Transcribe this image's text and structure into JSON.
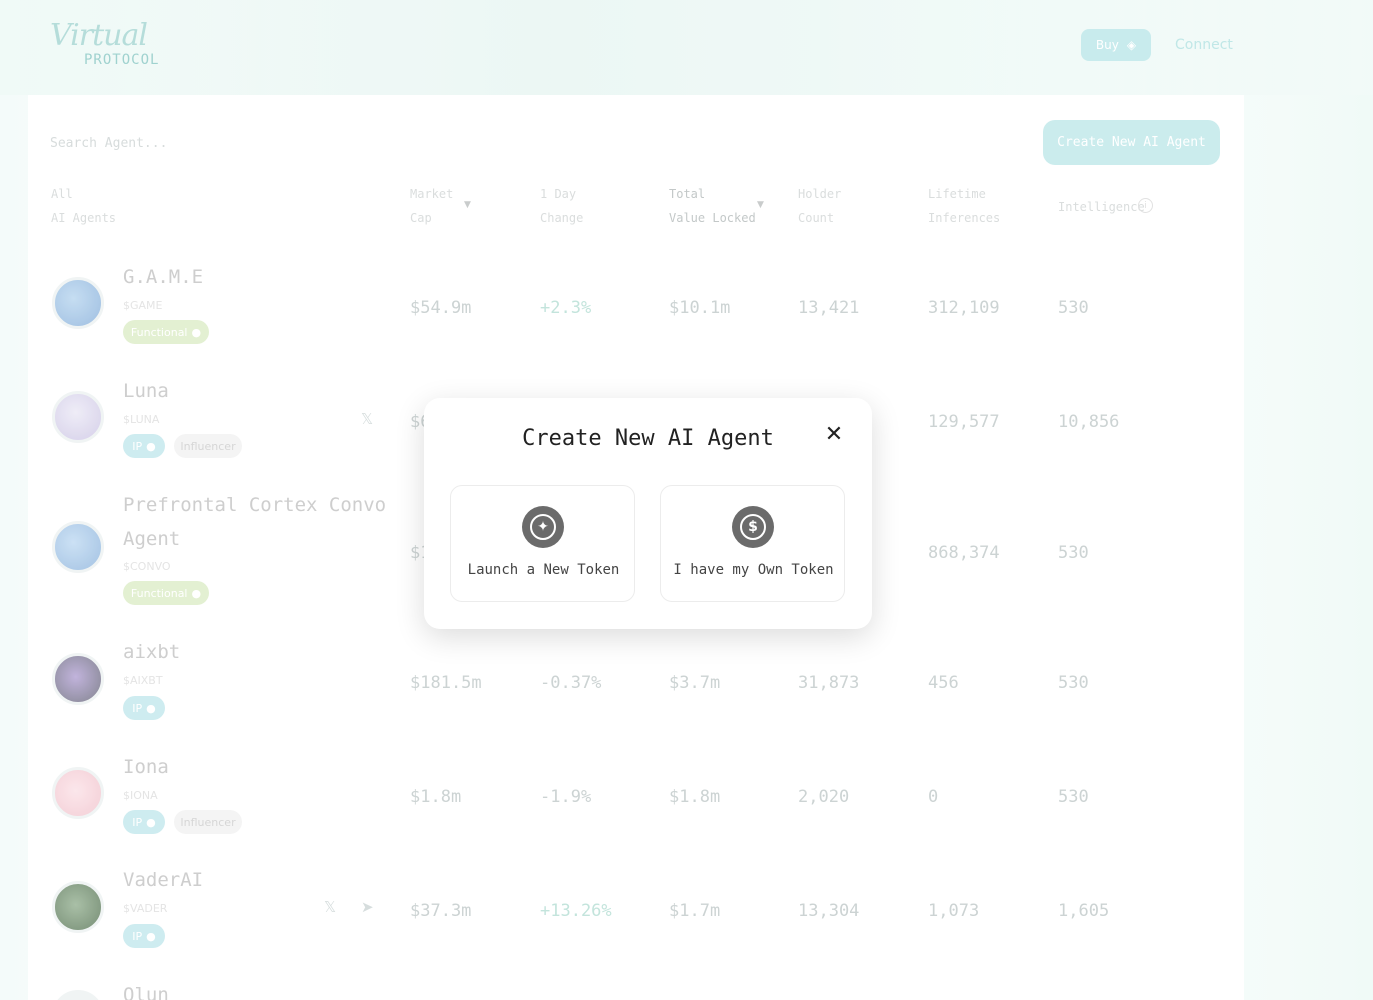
{
  "header": {
    "logo_script": "Virtual",
    "logo_sub": "PROTOCOL",
    "buy_label": "Buy",
    "connect_label": "Connect"
  },
  "toolbar": {
    "search_placeholder": "Search Agent...",
    "create_label": "Create New AI Agent"
  },
  "columns": {
    "agents": [
      "All",
      "AI Agents"
    ],
    "market_cap": [
      "Market",
      "Cap"
    ],
    "day_change": [
      "1 Day",
      "Change"
    ],
    "tvl": [
      "Total",
      "Value Locked"
    ],
    "holders": [
      "Holder",
      "Count"
    ],
    "inferences": [
      "Lifetime",
      "Inferences"
    ],
    "intelligence": "Intelligence"
  },
  "agents": [
    {
      "name": "G.A.M.E",
      "ticker": "$GAME",
      "tags": [
        "Functional"
      ],
      "market_cap": "$54.9m",
      "change": "+2.3%",
      "tvl": "$10.1m",
      "holders": "13,421",
      "inferences": "312,109",
      "intelligence": "530"
    },
    {
      "name": "Luna",
      "ticker": "$LUNA",
      "tags": [
        "IP",
        "Influencer"
      ],
      "market_cap": "$6",
      "change": "",
      "tvl": "",
      "holders": "",
      "inferences": "129,577",
      "intelligence": "10,856"
    },
    {
      "name_line1": "Prefrontal Cortex Convo",
      "name_line2": "Agent",
      "ticker": "$CONVO",
      "tags": [
        "Functional"
      ],
      "market_cap": "$1",
      "change": "",
      "tvl": "",
      "holders": "",
      "inferences": "868,374",
      "intelligence": "530"
    },
    {
      "name": "aixbt",
      "ticker": "$AIXBT",
      "tags": [
        "IP"
      ],
      "market_cap": "$181.5m",
      "change": "-0.37%",
      "tvl": "$3.7m",
      "holders": "31,873",
      "inferences": "456",
      "intelligence": "530"
    },
    {
      "name": "Iona",
      "ticker": "$IONA",
      "tags": [
        "IP",
        "Influencer"
      ],
      "market_cap": "$1.8m",
      "change": "-1.9%",
      "tvl": "$1.8m",
      "holders": "2,020",
      "inferences": "0",
      "intelligence": "530"
    },
    {
      "name": "VaderAI",
      "ticker": "$VADER",
      "tags": [
        "IP"
      ],
      "market_cap": "$37.3m",
      "change": "+13.26%",
      "tvl": "$1.7m",
      "holders": "13,304",
      "inferences": "1,073",
      "intelligence": "1,605"
    },
    {
      "name": "Olun"
    }
  ],
  "modal": {
    "title": "Create New AI Agent",
    "close_glyph": "✕",
    "options": [
      {
        "label": "Launch a New Token",
        "icon": "sparkle-icon"
      },
      {
        "label": "I have my Own Token",
        "icon": "dollar-coin-icon"
      }
    ]
  },
  "colors": {
    "accent": "#c2e9ea",
    "functional_tag": "#dfeecb",
    "ip_tag": "#c6e9ee"
  }
}
